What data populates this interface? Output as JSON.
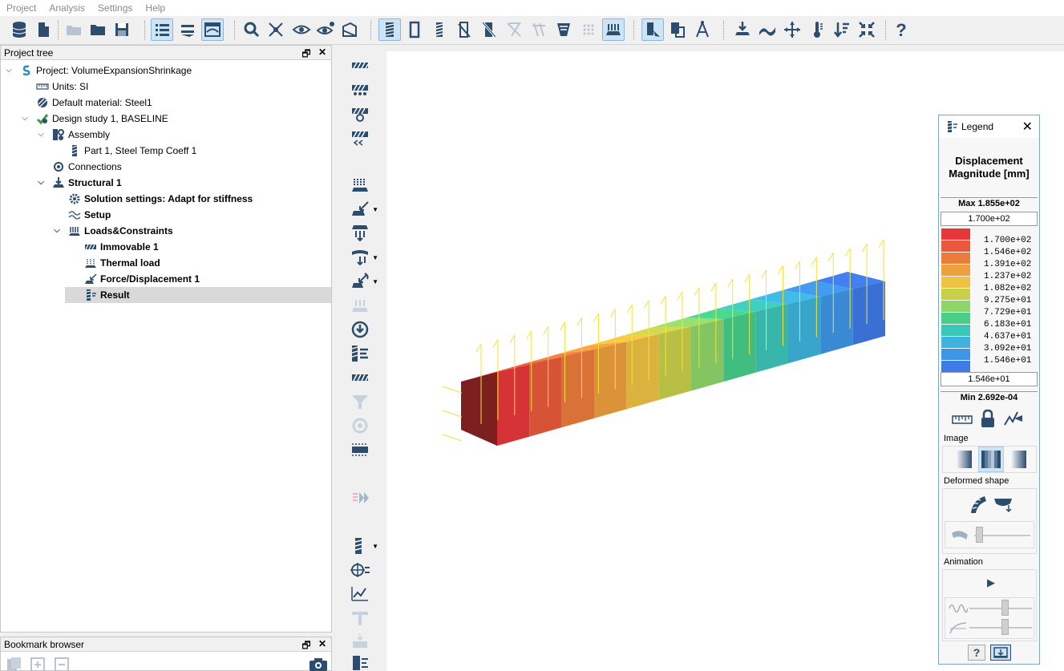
{
  "menu": [
    "Project",
    "Analysis",
    "Settings",
    "Help"
  ],
  "project_tree": {
    "title": "Project tree",
    "items": [
      {
        "label": "Project: VolumeExpansionShrinkage",
        "bold": false
      },
      {
        "label": "Units: SI",
        "bold": false
      },
      {
        "label": "Default material: Steel1",
        "bold": false
      },
      {
        "label": "Design study 1, BASELINE",
        "bold": false
      },
      {
        "label": "Assembly",
        "bold": false
      },
      {
        "label": "Part 1, Steel Temp Coeff 1",
        "bold": false
      },
      {
        "label": "Connections",
        "bold": false
      },
      {
        "label": "Structural  1",
        "bold": true
      },
      {
        "label": "Solution settings: Adapt for stiffness",
        "bold": true
      },
      {
        "label": "Setup",
        "bold": true
      },
      {
        "label": "Loads&Constraints",
        "bold": true
      },
      {
        "label": "Immovable 1",
        "bold": true
      },
      {
        "label": "Thermal load",
        "bold": true
      },
      {
        "label": "Force/Displacement 1",
        "bold": true
      },
      {
        "label": "Result",
        "bold": true
      }
    ]
  },
  "bookmark": {
    "title": "Bookmark browser"
  },
  "legend": {
    "title": "Legend",
    "heading_line1": "Displacement",
    "heading_line2": "Magnitude [mm]",
    "max_label": "Max  1.855e+02",
    "upper_value": "1.700e+02",
    "scale_labels": [
      "1.700e+02",
      "1.546e+02",
      "1.391e+02",
      "1.237e+02",
      "1.082e+02",
      "9.275e+01",
      "7.729e+01",
      "6.183e+01",
      "4.637e+01",
      "3.092e+01",
      "1.546e+01"
    ],
    "scale_colors": [
      "#e8373a",
      "#ea5a3a",
      "#ec7c3b",
      "#eda03d",
      "#eec242",
      "#c8d04a",
      "#8fd66a",
      "#47cf8a",
      "#3cc6b8",
      "#3eb3dd",
      "#3f95e6",
      "#3f7ae6"
    ],
    "lower_value": "1.546e+01",
    "min_label": "Min  2.692e-04",
    "image_section": "Image",
    "deformed_section": "Deformed shape",
    "animation_section": "Animation"
  }
}
